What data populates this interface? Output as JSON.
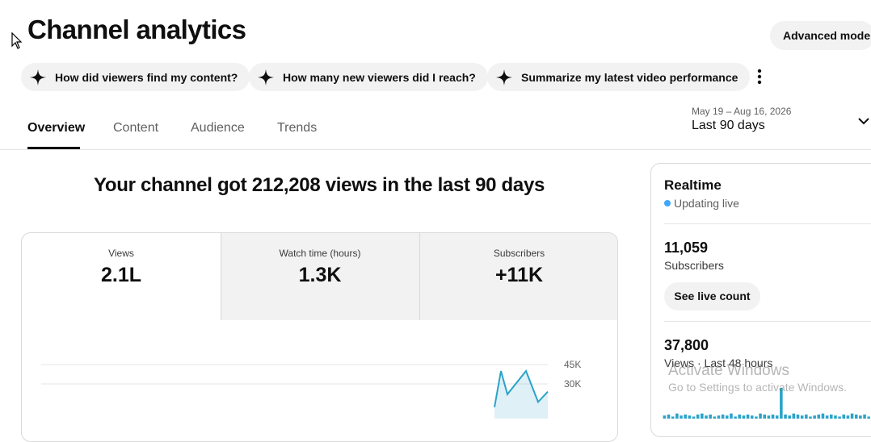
{
  "page": {
    "title": "Channel analytics"
  },
  "header": {
    "advanced_mode_label": "Advanced mode"
  },
  "suggestions": [
    {
      "label": "How did viewers find my content?",
      "icon": "sparkle-icon"
    },
    {
      "label": "How many new viewers did I reach?",
      "icon": "sparkle-icon"
    },
    {
      "label": "Summarize my latest video performance",
      "icon": "sparkle-icon"
    }
  ],
  "tabs": [
    {
      "label": "Overview",
      "active": true
    },
    {
      "label": "Content",
      "active": false
    },
    {
      "label": "Audience",
      "active": false
    },
    {
      "label": "Trends",
      "active": false
    }
  ],
  "date_picker": {
    "range": "May 19 – Aug 16, 2026",
    "label": "Last 90 days"
  },
  "headline": "Your channel got 212,208 views in the last 90 days",
  "metrics": [
    {
      "label": "Views",
      "value": "2.1L",
      "active": true
    },
    {
      "label": "Watch time (hours)",
      "value": "1.3K",
      "active": false
    },
    {
      "label": "Subscribers",
      "value": "+11K",
      "active": false
    }
  ],
  "chart_data": {
    "type": "line",
    "ytick_labels": [
      "45K",
      "30K"
    ],
    "ylim": [
      0,
      45000
    ],
    "series": [
      {
        "color": "#2ba3c9",
        "values": [
          12000,
          40000,
          22000,
          40000,
          16000,
          24000
        ]
      }
    ]
  },
  "realtime": {
    "title": "Realtime",
    "status": "Updating live",
    "subscribers_value": "11,059",
    "subscribers_label": "Subscribers",
    "live_count_button": "See live count",
    "views_value": "37,800",
    "views_label": "Views · Last 48 hours",
    "bars": [
      3,
      4,
      2,
      5,
      3,
      4,
      3,
      2,
      4,
      5,
      3,
      4,
      2,
      3,
      4,
      3,
      5,
      2,
      4,
      3,
      4,
      3,
      2,
      5,
      4,
      3,
      4,
      3,
      30,
      4,
      3,
      5,
      4,
      3,
      4,
      2,
      3,
      4,
      5,
      3,
      4,
      3,
      2,
      4,
      3,
      5,
      4,
      3,
      4,
      2
    ]
  },
  "watermark": {
    "line1": "Activate Windows",
    "line2": "Go to Settings to activate Windows."
  },
  "colors": {
    "accent": "#2ba3c9",
    "live_dot": "#3ea6ff",
    "chip_bg": "#f2f2f2"
  }
}
